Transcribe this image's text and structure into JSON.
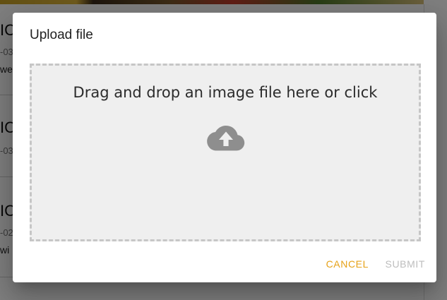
{
  "background": {
    "rows": [
      {
        "title": "IC",
        "date": "-03",
        "text": "we"
      },
      {
        "title": "IC",
        "date": "-03",
        "text": ""
      },
      {
        "title": "IC",
        "date": "-02",
        "text": "wi"
      }
    ]
  },
  "dialog": {
    "title": "Upload file",
    "dropzone_text": "Drag and drop an image file here or click",
    "upload_icon": "cloud-upload-icon",
    "cancel_label": "CANCEL",
    "submit_label": "SUBMIT"
  },
  "colors": {
    "accent": "#e6a218",
    "disabled": "#bdbdbd",
    "dropzone_bg": "#efefef",
    "dropzone_border": "#c6c6c6",
    "icon": "#8e8e8e"
  }
}
